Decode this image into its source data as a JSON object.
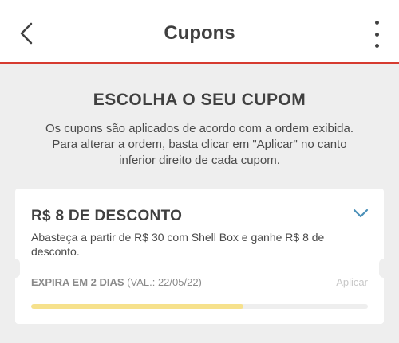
{
  "header": {
    "title": "Cupons",
    "back_icon": "chevron-left-icon",
    "menu_icon": "more-vertical-icon"
  },
  "intro": {
    "title": "ESCOLHA O SEU CUPOM",
    "line1": "Os cupons são aplicados de acordo com a ordem exibida.",
    "line2": "Para alterar a ordem, basta clicar em \"Aplicar\" no canto",
    "line3": "inferior direito de cada cupom."
  },
  "coupon": {
    "title": "R$ 8 DE DESCONTO",
    "description": "Abasteça a partir de R$ 30 com Shell Box e ganhe R$ 8 de desconto.",
    "expiry_label": "EXPIRA EM 2 DIAS",
    "validity": "(VAL.: 22/05/22)",
    "apply_label": "Aplicar",
    "progress_fraction": 0.63
  },
  "colors": {
    "accent_line": "#d63b2f",
    "chevron": "#4a90b8",
    "progress": "#f6e18c"
  }
}
